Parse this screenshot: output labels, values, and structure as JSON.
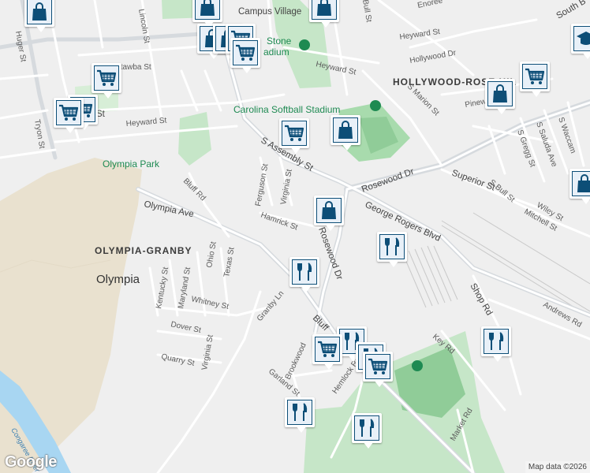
{
  "map": {
    "areas": {
      "campus_village": "Campus Village",
      "hollywood": "HOLLYWOOD-ROSE HIL",
      "olympia_granby": "OLYMPIA-GRANBY",
      "olympia": "Olympia",
      "olympia_park": "Olympia Park",
      "softball": "Carolina Softball Stadium",
      "stone_stadium_1": "Stone",
      "stone_stadium_2": "adium",
      "river": "Congaree River",
      "south_b": "South B"
    },
    "streets": {
      "huger": "Huger St",
      "lincoln": "Lincoln St",
      "catawba": "Catawba St",
      "tryon": "Tryon St",
      "heyward_left": "Heyward St",
      "heyward_top": "Heyward St",
      "heyward_mid": "Heyward St",
      "enoree": "Enoree",
      "hollywood_dr": "Hollywood Dr",
      "s_marion": "S Marion St",
      "pinewood": "Pinewo",
      "s_assembly": "S Assembly St",
      "rosewood_dr_right": "Rosewood Dr",
      "rosewood_dr_vertical": "Rosewood Dr",
      "superior": "Superior St",
      "s_bull": "S Bull St",
      "wiley": "Wiley St",
      "mitchell": "Mitchell St",
      "george_rogers": "George Rogers Blvd",
      "ferguson": "Ferguson St",
      "virginia_top": "Virginia St",
      "hamrick": "Hamrick St",
      "bluff_rd": "Bluff Rd",
      "bluff_lower": "Bluff",
      "olympia_ave": "Olympia Ave",
      "ohio": "Ohio St",
      "texas": "Texas St",
      "kentucky": "Kentucky St",
      "maryland": "Maryland St",
      "whitney": "Whitney St",
      "granby": "Granby Ln",
      "dover": "Dover St",
      "quarry": "Quarry St",
      "virginia_low": "Virginia St",
      "garland": "Garland St",
      "brookwood": "Brookwood",
      "hemlock": "Hemlock Rd",
      "key_rd": "Key Rd",
      "shop_rd": "Shop Rd",
      "andrews": "Andrews Rd",
      "market": "Market Rd",
      "s_gregg": "S Gregg St",
      "s_saluda": "S Saluda Ave",
      "s_waccamaw": "S Waccam",
      "bull_top": "Bull St",
      "st_left": "St"
    },
    "markers": [
      {
        "type": "shopping",
        "label": "shopping-bag-icon"
      },
      {
        "type": "grocery",
        "label": "shopping-cart-icon"
      },
      {
        "type": "restaurant",
        "label": "restaurant-icon"
      },
      {
        "type": "education",
        "label": "school-icon"
      }
    ]
  },
  "footer": {
    "logo": "Google",
    "attribution": "Map data ©2026"
  },
  "colors": {
    "background": "#efefef",
    "park": "#c6e6c8",
    "stadium": "#90cc98",
    "river": "#a8d6f2",
    "sand": "#e9e1cf",
    "road": "#ffffff",
    "highway": "#cfd4d9",
    "marker_border": "#0d4e77",
    "marker_fill": "#e8f0f8"
  }
}
